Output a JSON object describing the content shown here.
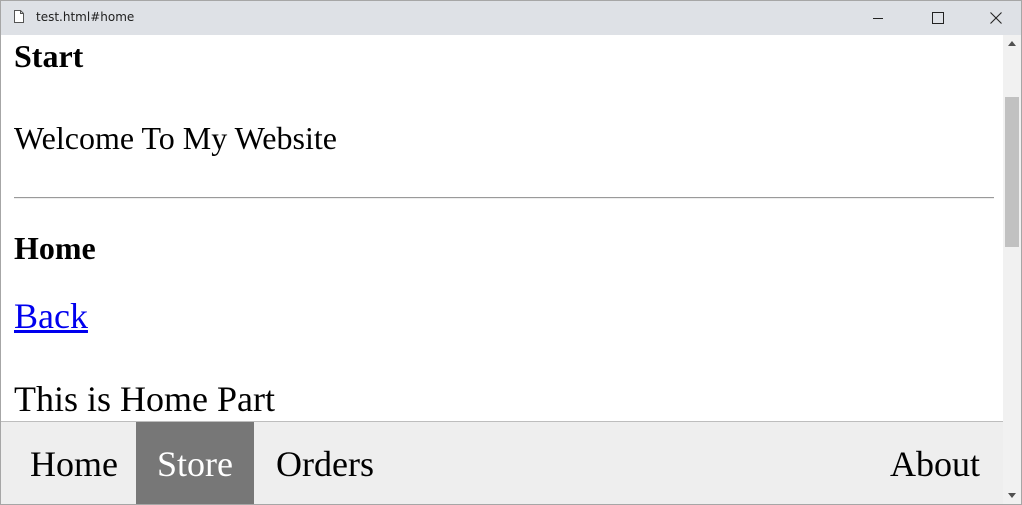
{
  "window": {
    "title": "test.html#home",
    "page_icon": "page-icon",
    "controls": {
      "minimize_icon": "minimize-icon",
      "maximize_icon": "maximize-icon",
      "close_icon": "close-icon"
    }
  },
  "content": {
    "start_heading": "Start",
    "welcome_text": "Welcome To My Website",
    "home_heading": "Home",
    "back_link": "Back",
    "home_part_text": "This is Home Part"
  },
  "navbar": {
    "items": [
      {
        "label": "Home",
        "active": false
      },
      {
        "label": "Store",
        "active": true
      },
      {
        "label": "Orders",
        "active": false
      },
      {
        "label": "About",
        "active": false
      }
    ],
    "active_color": "#777777",
    "background_color": "#eeeeee"
  },
  "colors": {
    "link": "#0000ee",
    "titlebar": "#dee1e6"
  }
}
